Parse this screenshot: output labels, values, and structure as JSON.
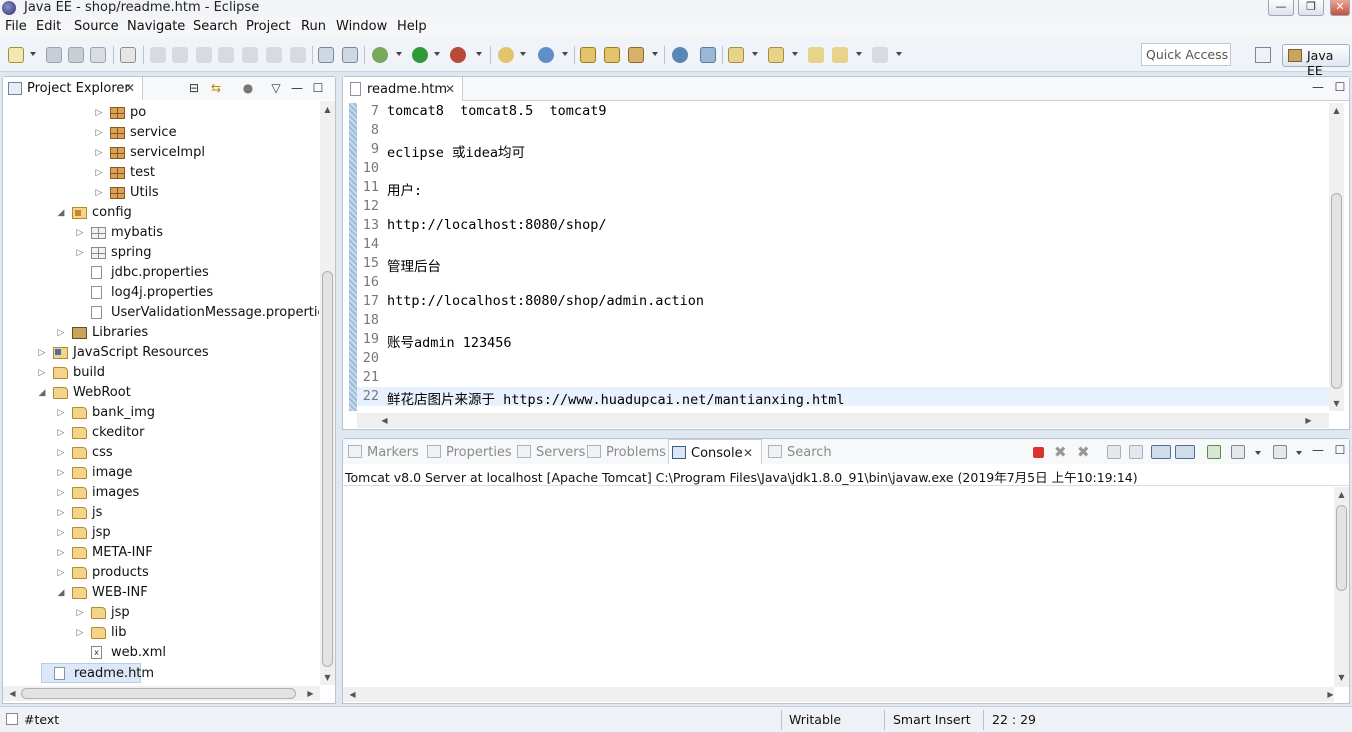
{
  "window": {
    "title": "Java EE - shop/readme.htm - Eclipse",
    "buttons": {
      "minimize": "—",
      "maximize": "❐",
      "close": "✕"
    }
  },
  "menu": [
    "File",
    "Edit",
    "Source",
    "Navigate",
    "Search",
    "Project",
    "Run",
    "Window",
    "Help"
  ],
  "toolbar": {
    "quick_access_placeholder": "Quick Access",
    "perspective_label": "Java EE"
  },
  "project_explorer": {
    "tab_label": "Project Explorer",
    "tree": [
      {
        "label": "po",
        "icon": "package-icon",
        "level": 4,
        "expandable": true
      },
      {
        "label": "service",
        "icon": "package-icon",
        "level": 4,
        "expandable": true
      },
      {
        "label": "serviceImpl",
        "icon": "package-icon",
        "level": 4,
        "expandable": true
      },
      {
        "label": "test",
        "icon": "package-icon",
        "level": 4,
        "expandable": true
      },
      {
        "label": "Utils",
        "icon": "package-icon",
        "level": 4,
        "expandable": true
      },
      {
        "label": "config",
        "icon": "source-folder-icon",
        "level": 2,
        "expanded": true
      },
      {
        "label": "mybatis",
        "icon": "empty-package-icon",
        "level": 3,
        "expandable": true
      },
      {
        "label": "spring",
        "icon": "empty-package-icon",
        "level": 3,
        "expandable": true
      },
      {
        "label": "jdbc.properties",
        "icon": "file-icon",
        "level": 3
      },
      {
        "label": "log4j.properties",
        "icon": "file-icon",
        "level": 3
      },
      {
        "label": "UserValidationMessage.properties",
        "icon": "file-icon",
        "level": 3
      },
      {
        "label": "Libraries",
        "icon": "library-icon",
        "level": 2,
        "expandable": true
      },
      {
        "label": "JavaScript Resources",
        "icon": "js-resources-icon",
        "level": 1,
        "expandable": true
      },
      {
        "label": "build",
        "icon": "folder-icon",
        "level": 1,
        "expandable": true
      },
      {
        "label": "WebRoot",
        "icon": "folder-icon",
        "level": 1,
        "expanded": true
      },
      {
        "label": "bank_img",
        "icon": "folder-icon",
        "level": 2,
        "expandable": true
      },
      {
        "label": "ckeditor",
        "icon": "folder-icon",
        "level": 2,
        "expandable": true
      },
      {
        "label": "css",
        "icon": "folder-icon",
        "level": 2,
        "expandable": true
      },
      {
        "label": "image",
        "icon": "folder-icon",
        "level": 2,
        "expandable": true
      },
      {
        "label": "images",
        "icon": "folder-icon",
        "level": 2,
        "expandable": true
      },
      {
        "label": "js",
        "icon": "folder-icon",
        "level": 2,
        "expandable": true
      },
      {
        "label": "jsp",
        "icon": "folder-icon",
        "level": 2,
        "expandable": true
      },
      {
        "label": "META-INF",
        "icon": "folder-icon",
        "level": 2,
        "expandable": true
      },
      {
        "label": "products",
        "icon": "folder-icon",
        "level": 2,
        "expandable": true
      },
      {
        "label": "WEB-INF",
        "icon": "folder-icon",
        "level": 2,
        "expanded": true
      },
      {
        "label": "jsp",
        "icon": "folder-icon",
        "level": 3,
        "expandable": true
      },
      {
        "label": "lib",
        "icon": "folder-icon",
        "level": 3,
        "expandable": true
      },
      {
        "label": "web.xml",
        "icon": "xml-file-icon",
        "level": 3
      },
      {
        "label": "readme.htm",
        "icon": "file-icon",
        "level": 1,
        "selected": true
      }
    ]
  },
  "editor": {
    "tab_label": "readme.htm",
    "lines": [
      {
        "n": "7",
        "text": "tomcat8  tomcat8.5  tomcat9"
      },
      {
        "n": "8",
        "text": ""
      },
      {
        "n": "9",
        "text": "eclipse 或idea均可"
      },
      {
        "n": "10",
        "text": ""
      },
      {
        "n": "11",
        "text": "用户:"
      },
      {
        "n": "12",
        "text": ""
      },
      {
        "n": "13",
        "text": "http://localhost:8080/shop/"
      },
      {
        "n": "14",
        "text": ""
      },
      {
        "n": "15",
        "text": "管理后台"
      },
      {
        "n": "16",
        "text": ""
      },
      {
        "n": "17",
        "text": "http://localhost:8080/shop/admin.action"
      },
      {
        "n": "18",
        "text": ""
      },
      {
        "n": "19",
        "text": "账号admin 123456"
      },
      {
        "n": "20",
        "text": ""
      },
      {
        "n": "21",
        "text": ""
      },
      {
        "n": "22",
        "text": "鲜花店图片来源于 https://www.huadupcai.net/mantianxing.html"
      }
    ]
  },
  "console": {
    "tabs": [
      "Markers",
      "Properties",
      "Servers",
      "Problems",
      "Console",
      "Search"
    ],
    "active_tab": "Console",
    "server_info": "Tomcat v8.0 Server at localhost [Apache Tomcat] C:\\Program Files\\Java\\jdk1.8.0_91\\bin\\javaw.exe (2019年7月5日 上午10:19:14)"
  },
  "status_bar": {
    "selection": "#text",
    "writable": "Writable",
    "insert_mode": "Smart Insert",
    "position": "22 : 29"
  },
  "colors": {
    "workbench_bg": "#dfe7f1",
    "selection": "#dce8f7",
    "current_line": "#e8f2fe",
    "stop_button": "#d9322f"
  }
}
